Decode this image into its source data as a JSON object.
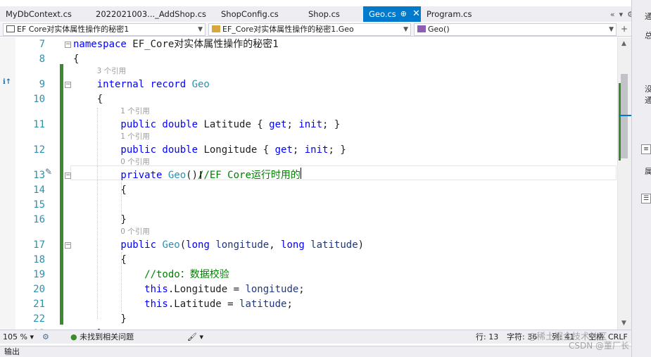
{
  "tabs": [
    {
      "label": "MyDbContext.cs"
    },
    {
      "label": "2022021003..._AddShop.cs"
    },
    {
      "label": "ShopConfig.cs"
    },
    {
      "label": "Shop.cs"
    },
    {
      "label": "Geo.cs",
      "active": true
    },
    {
      "label": "Program.cs"
    }
  ],
  "tab_tools": {
    "scroll_glyph": "«",
    "dropdown_glyph": "▾",
    "settings_glyph": "⚙"
  },
  "navbar": {
    "project": "EF Core对实体属性操作的秘密1",
    "type": "EF_Core对实体属性操作的秘密1.Geo",
    "member": "Geo()"
  },
  "editor": {
    "lines": [
      {
        "num": "7",
        "parts": [
          {
            "t": "namespace ",
            "c": "kw"
          },
          {
            "t": "EF_Core对实体属性操作的秘密1",
            "c": ""
          }
        ]
      },
      {
        "num": "8",
        "parts": [
          {
            "t": "{",
            "c": ""
          }
        ]
      },
      {
        "num": "9",
        "lens": "3 个引用",
        "parts": [
          {
            "t": "    internal record ",
            "c": "kw"
          },
          {
            "t": "Geo",
            "c": "ty"
          }
        ]
      },
      {
        "num": "10",
        "parts": [
          {
            "t": "    {",
            "c": ""
          }
        ]
      },
      {
        "num": "11",
        "lens": "1 个引用",
        "parts": [
          {
            "t": "        public double ",
            "c": "kw"
          },
          {
            "t": "Latitude { ",
            "c": ""
          },
          {
            "t": "get",
            "c": "kw"
          },
          {
            "t": "; ",
            "c": ""
          },
          {
            "t": "init",
            "c": "kw"
          },
          {
            "t": "; }",
            "c": ""
          }
        ]
      },
      {
        "num": "12",
        "lens": "1 个引用",
        "parts": [
          {
            "t": "        public double ",
            "c": "kw"
          },
          {
            "t": "Longitude { ",
            "c": ""
          },
          {
            "t": "get",
            "c": "kw"
          },
          {
            "t": "; ",
            "c": ""
          },
          {
            "t": "init",
            "c": "kw"
          },
          {
            "t": "; }",
            "c": ""
          }
        ]
      },
      {
        "num": "13",
        "lens": "0 个引用",
        "parts": [
          {
            "t": "        private ",
            "c": "kw"
          },
          {
            "t": "Geo",
            "c": "ty"
          },
          {
            "t": "()",
            "c": ""
          },
          {
            "t": "//EF Core运行时用的",
            "c": "cm"
          }
        ]
      },
      {
        "num": "14",
        "parts": [
          {
            "t": "        {",
            "c": ""
          }
        ]
      },
      {
        "num": "15",
        "parts": [
          {
            "t": "",
            "c": ""
          }
        ]
      },
      {
        "num": "16",
        "parts": [
          {
            "t": "        }",
            "c": ""
          }
        ]
      },
      {
        "num": "17",
        "lens": "0 个引用",
        "parts": [
          {
            "t": "        public ",
            "c": "kw"
          },
          {
            "t": "Geo",
            "c": "ty"
          },
          {
            "t": "(",
            "c": ""
          },
          {
            "t": "long ",
            "c": "kw"
          },
          {
            "t": "longitude",
            "c": "id"
          },
          {
            "t": ", ",
            "c": ""
          },
          {
            "t": "long ",
            "c": "kw"
          },
          {
            "t": "latitude",
            "c": "id"
          },
          {
            "t": ")",
            "c": ""
          }
        ]
      },
      {
        "num": "18",
        "parts": [
          {
            "t": "        {",
            "c": ""
          }
        ]
      },
      {
        "num": "19",
        "parts": [
          {
            "t": "            //todo：数据校验",
            "c": "cm"
          }
        ]
      },
      {
        "num": "20",
        "parts": [
          {
            "t": "            this",
            "c": "kw"
          },
          {
            "t": ".Longitude = ",
            "c": ""
          },
          {
            "t": "longitude",
            "c": "id"
          },
          {
            "t": ";",
            "c": ""
          }
        ]
      },
      {
        "num": "21",
        "parts": [
          {
            "t": "            this",
            "c": "kw"
          },
          {
            "t": ".Latitude = ",
            "c": ""
          },
          {
            "t": "latitude",
            "c": "id"
          },
          {
            "t": ";",
            "c": ""
          }
        ]
      },
      {
        "num": "22",
        "parts": [
          {
            "t": "        }",
            "c": ""
          }
        ]
      },
      {
        "num": "23",
        "parts": [
          {
            "t": "    }",
            "c": ""
          }
        ]
      }
    ]
  },
  "statusbar": {
    "zoom": "105 %",
    "issues": "未找到相关问题",
    "line": "行: 13",
    "char": "字符: 36",
    "col": "列: 41",
    "mode": "空格",
    "eol": "CRLF"
  },
  "watermark": {
    "text": "@稀土掘金技术社区",
    "text2": "CSDN @董厂长"
  },
  "right_panel": {
    "t1": "通",
    "t2": "总",
    "t3": "没",
    "t4": "通",
    "t5": "属"
  },
  "output": {
    "label": "输出"
  },
  "colors": {
    "accent": "#007acc",
    "change_bar": "#3a8a2e",
    "keyword": "#0000ff",
    "type": "#2b91af",
    "comment": "#008000"
  }
}
